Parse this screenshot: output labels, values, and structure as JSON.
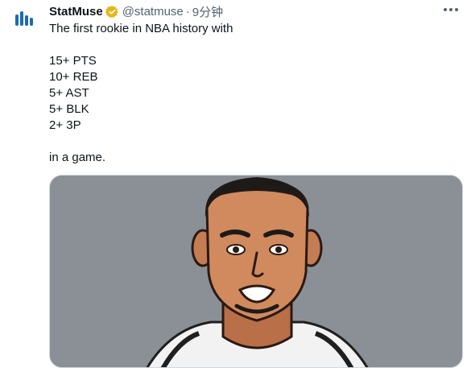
{
  "tweet": {
    "display_name": "StatMuse",
    "handle": "@statmuse",
    "separator": "·",
    "time": "9分钟",
    "lines": [
      "The first rookie in NBA history with",
      "",
      "15+ PTS",
      "10+ REB",
      "5+ AST",
      "5+ BLK",
      "2+ 3P",
      "",
      "in a game."
    ]
  },
  "icons": {
    "avatar": "statmuse-logo-icon",
    "verified": "gold-verified-badge-icon",
    "more": "more-options-icon"
  },
  "colors": {
    "text": "#0f1419",
    "muted": "#536471",
    "verified_gold": "#e2b719",
    "logo_blue": "#1b6bb0",
    "media_bg": "#8b9096"
  }
}
